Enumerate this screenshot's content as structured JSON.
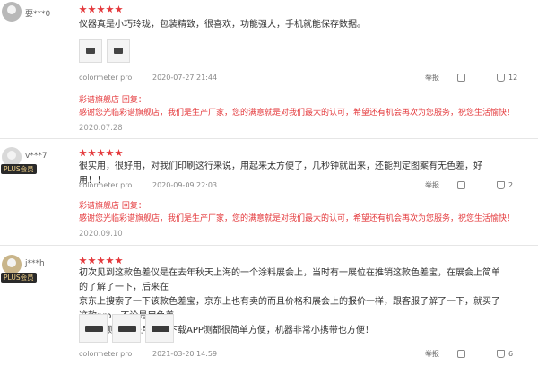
{
  "reviews": [
    {
      "username": "要***0",
      "plus_badge": "",
      "text": "仪器真是小巧玲珑，包装精致，很喜欢，功能强大，手机就能保存数据。",
      "product": "colormeter pro",
      "date": "2020-07-27 21:44",
      "report": "举报",
      "comments": "",
      "likes": "12",
      "reply_header": "彩谱旗舰店 回复：",
      "reply_text": "感谢您光临彩谱旗舰店，我们是生产厂家，您的满意就是对我们最大的认可，希望还有机会再次为您服务，祝您生活愉快！",
      "reply_date": "2020.07.28"
    },
    {
      "username": "v***7",
      "plus_badge": "PLUS会员",
      "text": "很实用，很好用，对我们印刷这行来说，用起来太方便了，几秒钟就出来，还能判定图案有无色差，好用！！",
      "product": "colormeter pro",
      "date": "2020-09-09 22:03",
      "report": "举报",
      "comments": "",
      "likes": "2",
      "reply_header": "彩谱旗舰店 回复：",
      "reply_text": "感谢您光临彩谱旗舰店，我们是生产厂家，您的满意就是对我们最大的认可，希望还有机会再次为您服务，祝您生活愉快！",
      "reply_date": "2020.09.10"
    },
    {
      "username": "j***h",
      "plus_badge": "PLUS会员",
      "text_line1": "初次见到这款色差仪是在去年秋天上海的一个涂料展会上，当时有一展位在推销这款色差宝，在展会上简单的了解了一下，后来在",
      "text_line2": "京东上搜索了一下该款色差宝，京东上也有卖的而且价格和展会上的报价一样，跟客服了解了一下，就买了这款pro，不论是用色差",
      "text_line3": "宝直接测，还是用手机下载APP测都很简单方便，机器非常小携带也方便！",
      "product": "colormeter pro",
      "date": "2021-03-20 14:59",
      "report": "举报",
      "comments": "",
      "likes": "6"
    }
  ]
}
